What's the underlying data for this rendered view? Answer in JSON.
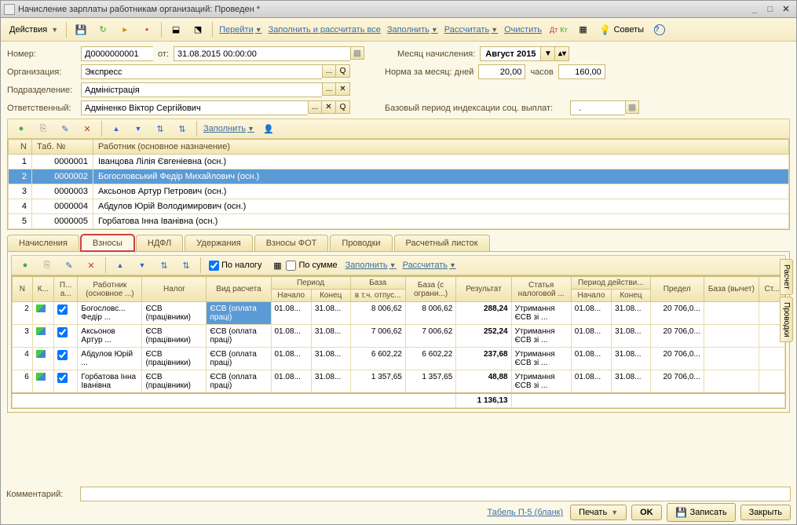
{
  "window": {
    "title": "Начисление зарплаты работникам организаций: Проведен *"
  },
  "toolbar": {
    "actions": "Действия",
    "goto": "Перейти",
    "fill_calc_all": "Заполнить и рассчитать все",
    "fill": "Заполнить",
    "calc": "Рассчитать",
    "clear": "Очистить",
    "tips": "Советы"
  },
  "header": {
    "number_lbl": "Номер:",
    "number": "Д0000000001",
    "from_lbl": "от:",
    "date": "31.08.2015 00:00:00",
    "org_lbl": "Организация:",
    "org": "Экспресс",
    "dept_lbl": "Подразделение:",
    "dept": "Адміністрація",
    "resp_lbl": "Ответственный:",
    "resp": "Адміненко Віктор Сергійович",
    "month_lbl": "Месяц начисления:",
    "month": "Август 2015",
    "norm_lbl": "Норма за месяц: дней",
    "norm_days": "20,00",
    "hours_lbl": "часов",
    "norm_hours": "160,00",
    "index_lbl": "Базовый период индексации соц. выплат:",
    "index_val": "  .    "
  },
  "mini": {
    "fill": "Заполнить"
  },
  "empgrid": {
    "cols": {
      "n": "N",
      "tab": "Таб. №",
      "worker": "Работник (основное назначение)"
    },
    "rows": [
      {
        "n": "1",
        "tab": "0000001",
        "name": "Іванцова Лілія Євгеніевна (осн.)"
      },
      {
        "n": "2",
        "tab": "0000002",
        "name": "Богословський Федір Михайлович (осн.)"
      },
      {
        "n": "3",
        "tab": "0000003",
        "name": "Аксьонов Артур Петрович (осн.)"
      },
      {
        "n": "4",
        "tab": "0000004",
        "name": "Абдулов Юрій Володимирович (осн.)"
      },
      {
        "n": "5",
        "tab": "0000005",
        "name": "Горбатова Інна Іванівна (осн.)"
      }
    ]
  },
  "tabs": {
    "t0": "Начисления",
    "t1": "Взносы",
    "t2": "НДФЛ",
    "t3": "Удержания",
    "t4": "Взносы ФОТ",
    "t5": "Проводки",
    "t6": "Расчетный листок"
  },
  "subtb": {
    "bytax": "По налогу",
    "bysum": "По сумме",
    "fill": "Заполнить",
    "calc": "Рассчитать"
  },
  "subgrid": {
    "cols": {
      "n": "N",
      "k": "К...",
      "p": "П... а...",
      "worker": "Работник (основное ...)",
      "tax": "Налог",
      "calc": "Вид расчета",
      "period": "Период",
      "pstart": "Начало",
      "pend": "Конец",
      "base": "База",
      "base_ot": "в т.ч. отпус...",
      "base_lim": "База (с ограни...)",
      "result": "Результат",
      "article": "Статья налоговой ...",
      "action": "Период действи...",
      "astart": "Начало",
      "aend": "Конец",
      "limit": "Предел",
      "base_ded": "База (вычет)",
      "st": "Ст..."
    },
    "rows": [
      {
        "n": "2",
        "w": "Богословс... Федір ...",
        "tax": "ЄСВ (працівники)",
        "calc": "ЄСВ (оплата праці)",
        "ps": "01.08...",
        "pe": "31.08...",
        "base": "8 006,62",
        "blim": "8 006,62",
        "res": "288,24",
        "art": "Утримання ЄСВ зі ...",
        "as": "01.08...",
        "ae": "31.08...",
        "lim": "20 706,0..."
      },
      {
        "n": "3",
        "w": "Аксьонов Артур ...",
        "tax": "ЄСВ (працівники)",
        "calc": "ЄСВ (оплата праці)",
        "ps": "01.08...",
        "pe": "31.08...",
        "base": "7 006,62",
        "blim": "7 006,62",
        "res": "252,24",
        "art": "Утримання ЄСВ зі ...",
        "as": "01.08...",
        "ae": "31.08...",
        "lim": "20 706,0..."
      },
      {
        "n": "4",
        "w": "Абдулов Юрій ...",
        "tax": "ЄСВ (працівники)",
        "calc": "ЄСВ (оплата праці)",
        "ps": "01.08...",
        "pe": "31.08...",
        "base": "6 602,22",
        "blim": "6 602,22",
        "res": "237,68",
        "art": "Утримання ЄСВ зі ...",
        "as": "01.08...",
        "ae": "31.08...",
        "lim": "20 706,0..."
      },
      {
        "n": "6",
        "w": "Горбатова Інна Іванівна",
        "tax": "ЄСВ (працівники)",
        "calc": "ЄСВ (оплата праці)",
        "ps": "01.08...",
        "pe": "31.08...",
        "base": "1 357,65",
        "blim": "1 357,65",
        "res": "48,88",
        "art": "Утримання ЄСВ зі ...",
        "as": "01.08...",
        "ae": "31.08...",
        "lim": "20 706,0..."
      }
    ],
    "total": "1 136,13"
  },
  "sidetabs": {
    "s1": "Расчет",
    "s2": "Проводки"
  },
  "footer": {
    "comment_lbl": "Комментарий:"
  },
  "btns": {
    "tabel": "Табель П-5 (бланк)",
    "print": "Печать",
    "ok": "OK",
    "save": "Записать",
    "close": "Закрыть"
  }
}
